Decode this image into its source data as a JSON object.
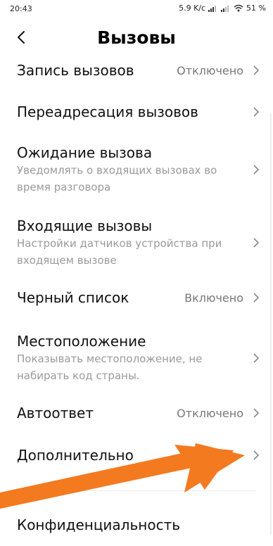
{
  "status_bar": {
    "time": "20:43",
    "network_speed": "5.9 K/c",
    "battery": "51 %",
    "icons": [
      "signal-icon",
      "signal-icon",
      "wifi-icon",
      "battery-icon"
    ]
  },
  "header": {
    "title": "Вызовы",
    "back_icon": "chevron-left-icon"
  },
  "settings": [
    {
      "title": "Запись вызовов",
      "value": "Отключено"
    },
    {
      "title": "Переадресация вызовов"
    },
    {
      "title": "Ожидание вызова",
      "subtitle_lines": [
        "Уведомлять о входящих вызовах во",
        "время разговора"
      ]
    },
    {
      "title": "Входящие вызовы",
      "subtitle_lines": [
        "Настройки датчиков устройства при",
        "входящем вызове"
      ]
    },
    {
      "title": "Черный список",
      "value": "Включено"
    },
    {
      "title": "Местоположение",
      "subtitle_lines": [
        "Показывать местоположение, не",
        "набирать код страны."
      ]
    },
    {
      "title": "Автоответ",
      "value": "Отключено"
    },
    {
      "title": "Дополнительно"
    },
    {
      "title": "Конфиденциальность"
    }
  ],
  "colors": {
    "annotation_arrow": "#F47A20",
    "subtitle_text": "#9a9a9a",
    "value_text": "#777777"
  }
}
